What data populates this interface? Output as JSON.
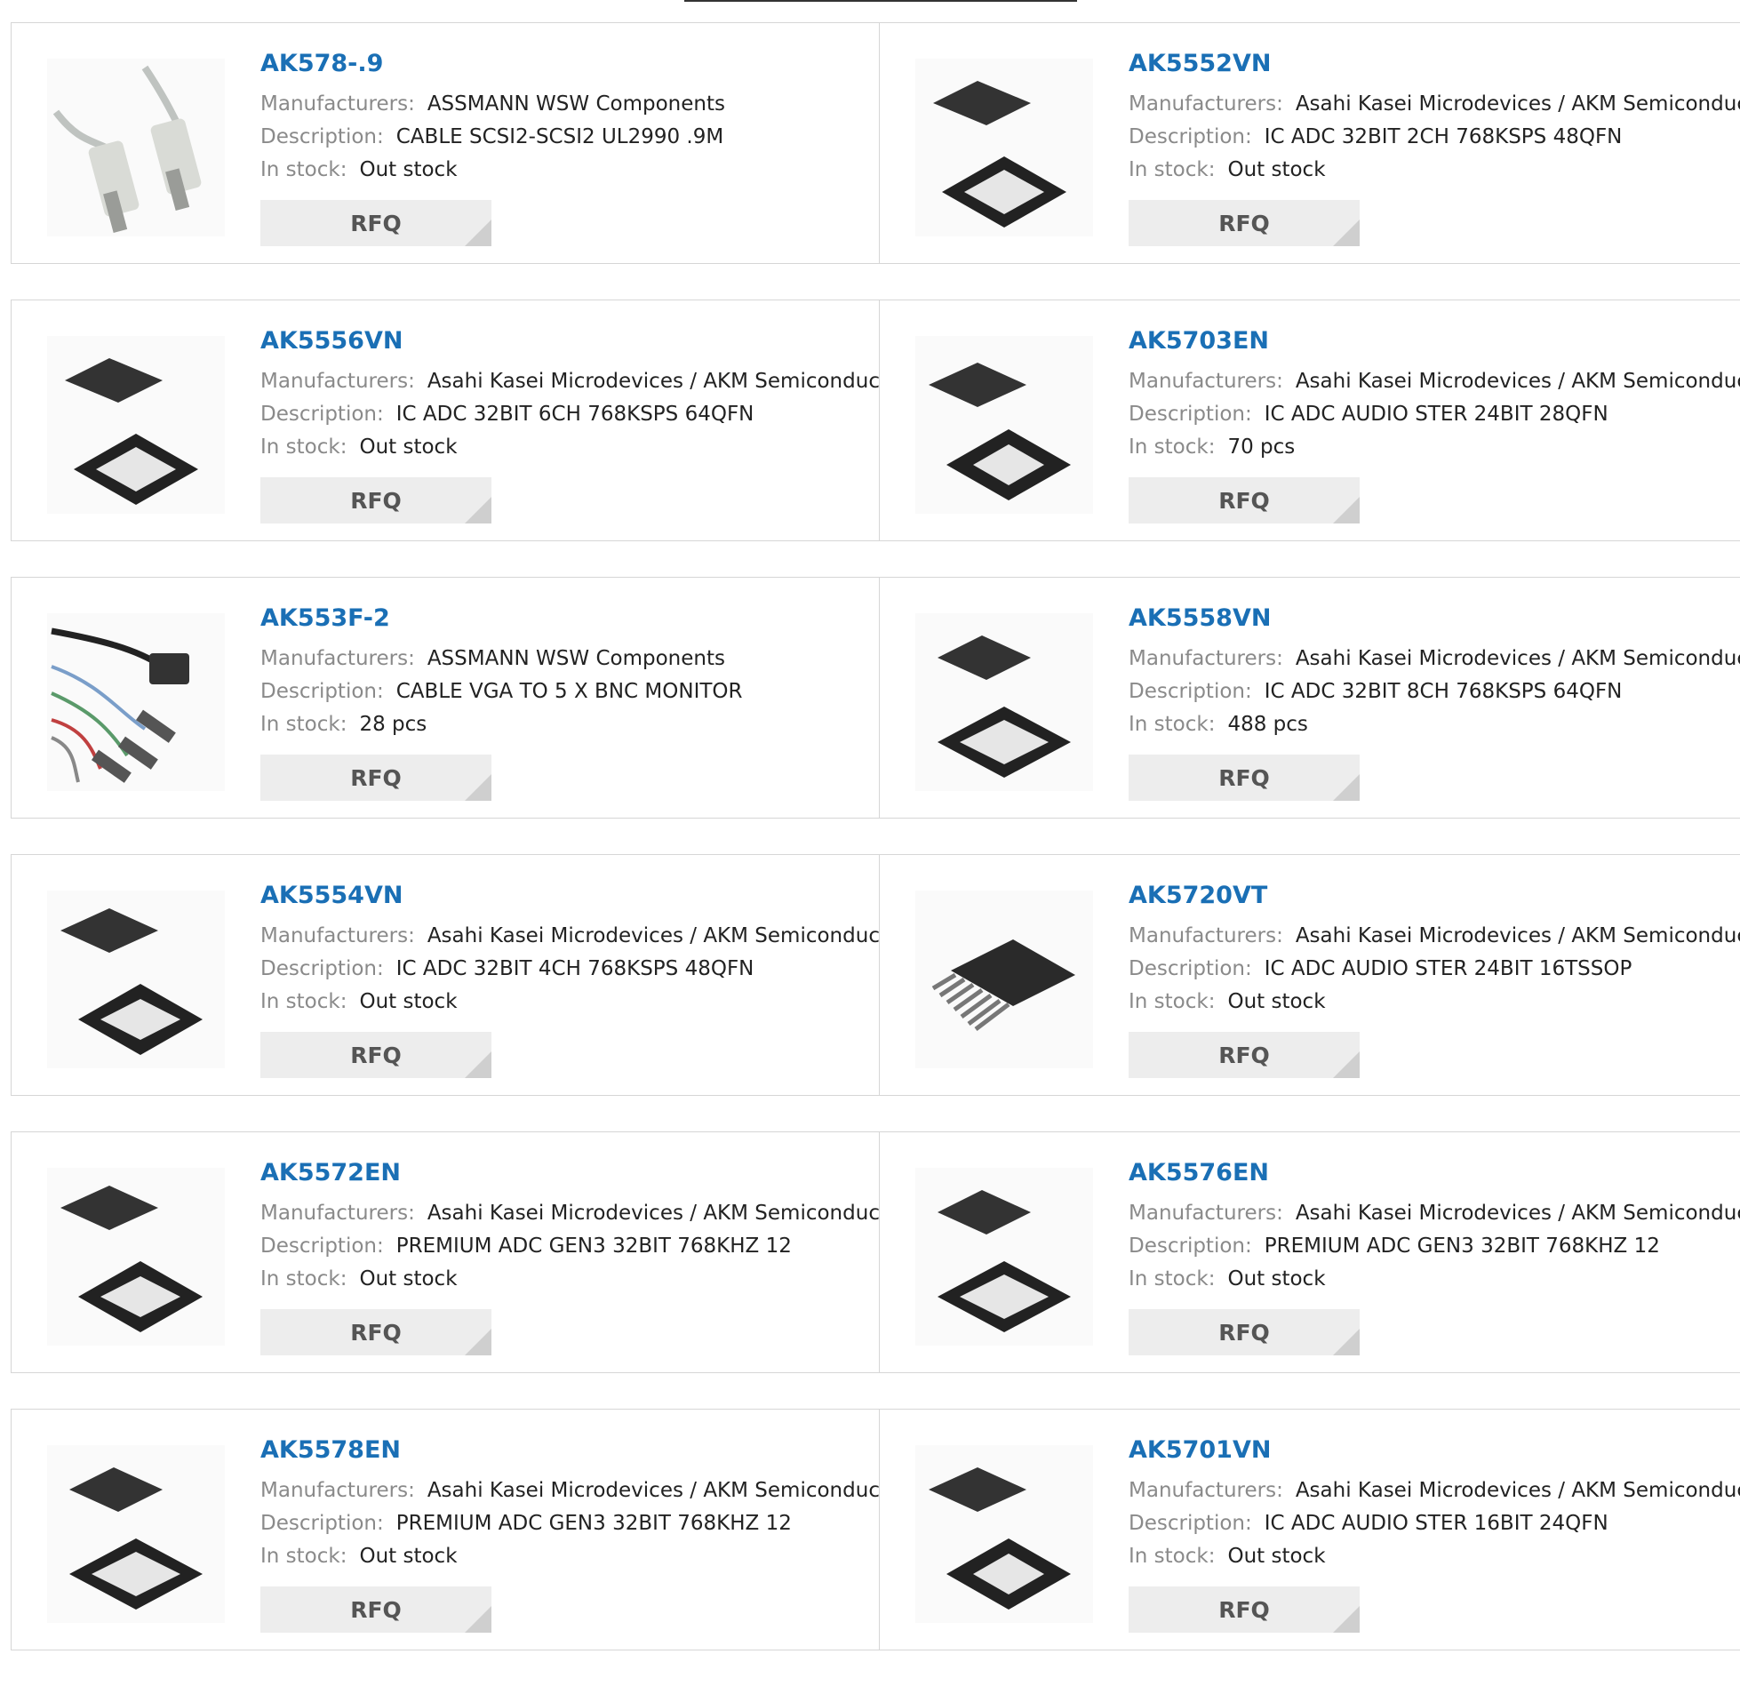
{
  "labels": {
    "manufacturers": "Manufacturers:",
    "description": "Description:",
    "in_stock": "In stock:",
    "rfq": "RFQ"
  },
  "products": [
    {
      "part": "AK578-.9",
      "manufacturer": "ASSMANN WSW Components",
      "description": "CABLE SCSI2-SCSI2 UL2990 .9M",
      "stock": "Out stock",
      "image": "cable-icon"
    },
    {
      "part": "AK5552VN",
      "manufacturer": "Asahi Kasei Microdevices / AKM Semiconductor",
      "description": "IC ADC 32BIT 2CH 768KSPS 48QFN",
      "stock": "Out stock",
      "image": "chip-qfn-icon"
    },
    {
      "part": "AK5556VN",
      "manufacturer": "Asahi Kasei Microdevices / AKM Semiconductor",
      "description": "IC ADC 32BIT 6CH 768KSPS 64QFN",
      "stock": "Out stock",
      "image": "chip-qfn-icon"
    },
    {
      "part": "AK5703EN",
      "manufacturer": "Asahi Kasei Microdevices / AKM Semiconductor",
      "description": "IC ADC AUDIO STER 24BIT 28QFN",
      "stock": "70 pcs",
      "image": "chip-qfn-icon"
    },
    {
      "part": "AK553F-2",
      "manufacturer": "ASSMANN WSW Components",
      "description": "CABLE VGA TO 5 X BNC MONITOR",
      "stock": "28 pcs",
      "image": "cable-icon"
    },
    {
      "part": "AK5558VN",
      "manufacturer": "Asahi Kasei Microdevices / AKM Semiconductor",
      "description": "IC ADC 32BIT 8CH 768KSPS 64QFN",
      "stock": "488 pcs",
      "image": "chip-qfn-icon"
    },
    {
      "part": "AK5554VN",
      "manufacturer": "Asahi Kasei Microdevices / AKM Semiconductor",
      "description": "IC ADC 32BIT 4CH 768KSPS 48QFN",
      "stock": "Out stock",
      "image": "chip-qfn-icon"
    },
    {
      "part": "AK5720VT",
      "manufacturer": "Asahi Kasei Microdevices / AKM Semiconductor",
      "description": "IC ADC AUDIO STER 24BIT 16TSSOP",
      "stock": "Out stock",
      "image": "chip-tssop-icon"
    },
    {
      "part": "AK5572EN",
      "manufacturer": "Asahi Kasei Microdevices / AKM Semiconductor",
      "description": "PREMIUM ADC GEN3 32BIT 768KHZ 12",
      "stock": "Out stock",
      "image": "chip-qfn-icon"
    },
    {
      "part": "AK5576EN",
      "manufacturer": "Asahi Kasei Microdevices / AKM Semiconductor",
      "description": "PREMIUM ADC GEN3 32BIT 768KHZ 12",
      "stock": "Out stock",
      "image": "chip-qfn-icon"
    },
    {
      "part": "AK5578EN",
      "manufacturer": "Asahi Kasei Microdevices / AKM Semiconductor",
      "description": "PREMIUM ADC GEN3 32BIT 768KHZ 12",
      "stock": "Out stock",
      "image": "chip-qfn-icon"
    },
    {
      "part": "AK5701VN",
      "manufacturer": "Asahi Kasei Microdevices / AKM Semiconductor",
      "description": "IC ADC AUDIO STER 16BIT 24QFN",
      "stock": "Out stock",
      "image": "chip-qfn-icon"
    }
  ]
}
